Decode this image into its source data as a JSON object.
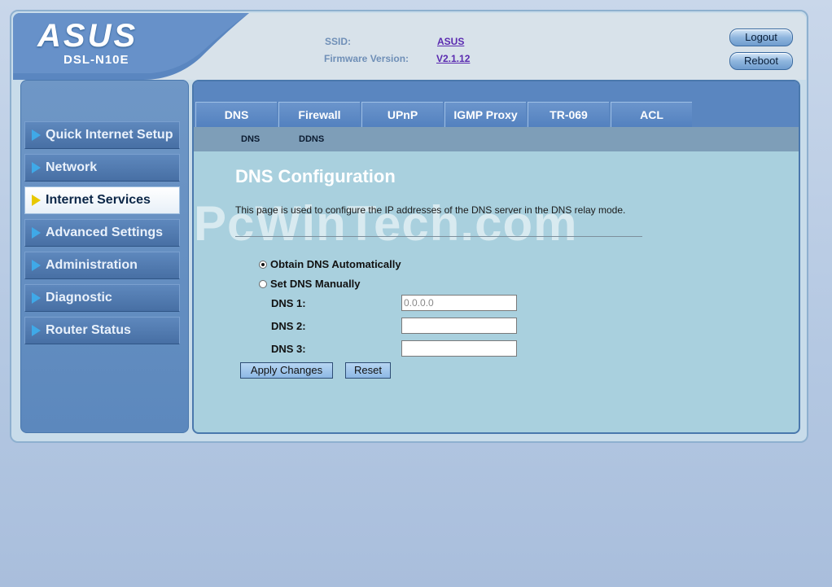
{
  "header": {
    "brand": "ASUS",
    "model": "DSL-N10E",
    "ssid_label": "SSID:",
    "ssid_value": "ASUS",
    "firmware_label": "Firmware Version:",
    "firmware_value": "V2.1.12",
    "logout_label": "Logout",
    "reboot_label": "Reboot"
  },
  "sidebar": {
    "items": [
      {
        "label": "Quick Internet Setup",
        "active": false
      },
      {
        "label": "Network",
        "active": false
      },
      {
        "label": "Internet Services",
        "active": true
      },
      {
        "label": "Advanced Settings",
        "active": false
      },
      {
        "label": "Administration",
        "active": false
      },
      {
        "label": "Diagnostic",
        "active": false
      },
      {
        "label": "Router Status",
        "active": false
      }
    ]
  },
  "tabs": [
    "DNS",
    "Firewall",
    "UPnP",
    "IGMP Proxy",
    "TR-069",
    "ACL"
  ],
  "subtabs": [
    "DNS",
    "DDNS"
  ],
  "main": {
    "title": "DNS Configuration",
    "description": "This page is used to configure the IP addresses of the DNS server in the DNS relay mode.",
    "watermark": "PcWinTech.com",
    "radio_auto": "Obtain DNS Automatically",
    "radio_manual": "Set DNS Manually",
    "selected_mode": "auto",
    "dns1_label": "DNS 1:",
    "dns1_value": "0.0.0.0",
    "dns2_label": "DNS 2:",
    "dns2_value": "",
    "dns3_label": "DNS 3:",
    "dns3_value": "",
    "apply_label": "Apply Changes",
    "reset_label": "Reset"
  },
  "colors": {
    "accent": "#5a86c0",
    "content_bg": "#a9d0de",
    "active_arrow": "#e8c800",
    "inactive_arrow": "#3fa9e8"
  }
}
